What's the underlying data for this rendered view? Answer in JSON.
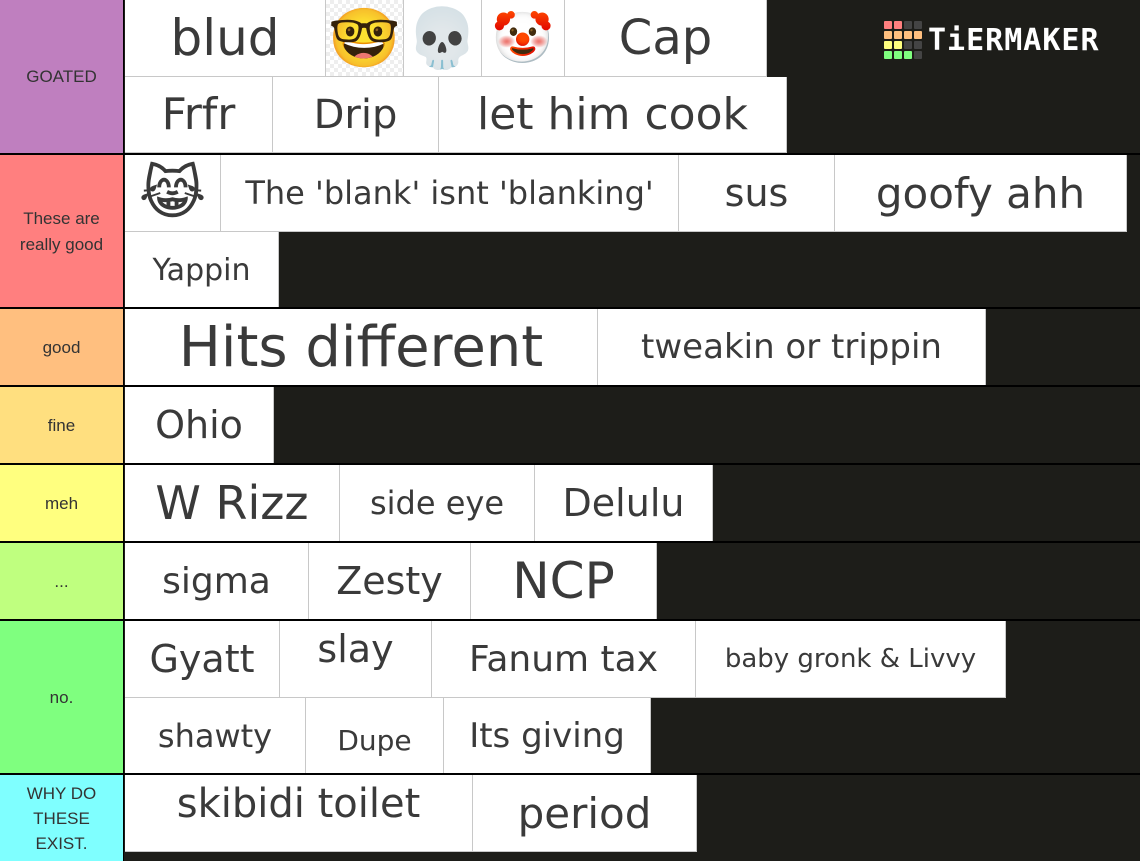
{
  "logo": {
    "text": "TiERMAKER",
    "grid_colors": [
      "#ff7f7f",
      "#ff7f7f",
      "#444444",
      "#444444",
      "#ffbf7f",
      "#ffbf7f",
      "#ffbf7f",
      "#ffbf7f",
      "#ffff7f",
      "#ffff7f",
      "#444444",
      "#444444",
      "#7fff7f",
      "#7fff7f",
      "#7fff7f",
      "#444444"
    ]
  },
  "tiers": [
    {
      "label": "GOATED",
      "color": "#bf7fbf",
      "items": [
        {
          "text": "blud",
          "type": "text"
        },
        {
          "text": "🤓",
          "type": "emoji",
          "name": "nerd-face-emoji"
        },
        {
          "text": "💀",
          "type": "emoji",
          "name": "skull-emoji"
        },
        {
          "text": "🤡",
          "type": "emoji",
          "name": "clown-face-emoji"
        },
        {
          "text": "Cap",
          "type": "text"
        },
        {
          "text": "Frfr",
          "type": "text"
        },
        {
          "text": "Drip",
          "type": "text"
        },
        {
          "text": "let him cook",
          "type": "text"
        }
      ]
    },
    {
      "label": "These are really good",
      "color": "#ff7f7f",
      "items": [
        {
          "text": "😹",
          "type": "emoji",
          "name": "cat-tears-of-joy-emoji"
        },
        {
          "text": "The 'blank' isnt 'blanking'",
          "type": "text"
        },
        {
          "text": "sus",
          "type": "text"
        },
        {
          "text": "goofy ahh",
          "type": "text"
        },
        {
          "text": "Yappin",
          "type": "text"
        }
      ]
    },
    {
      "label": "good",
      "color": "#ffbf7f",
      "items": [
        {
          "text": "Hits different",
          "type": "text"
        },
        {
          "text": "tweakin or trippin",
          "type": "text"
        }
      ]
    },
    {
      "label": "fine",
      "color": "#ffdf7f",
      "items": [
        {
          "text": "Ohio",
          "type": "text"
        }
      ]
    },
    {
      "label": "meh",
      "color": "#ffff7f",
      "items": [
        {
          "text": "W Rizz",
          "type": "text"
        },
        {
          "text": "side eye",
          "type": "text"
        },
        {
          "text": "Delulu",
          "type": "text"
        }
      ]
    },
    {
      "label": "...",
      "color": "#bfff7f",
      "items": [
        {
          "text": "sigma",
          "type": "text"
        },
        {
          "text": "Zesty",
          "type": "text"
        },
        {
          "text": "NCP",
          "type": "text"
        }
      ]
    },
    {
      "label": "no.",
      "color": "#7fff7f",
      "items": [
        {
          "text": "Gyatt",
          "type": "text"
        },
        {
          "text": "slay",
          "type": "text"
        },
        {
          "text": "Fanum tax",
          "type": "text"
        },
        {
          "text": "baby gronk & Livvy",
          "type": "text"
        },
        {
          "text": "shawty",
          "type": "text"
        },
        {
          "text": "Dupe",
          "type": "text"
        },
        {
          "text": "Its giving",
          "type": "text"
        }
      ]
    },
    {
      "label": "WHY DO THESE EXIST.",
      "color": "#7fffff",
      "items": [
        {
          "text": "skibidi toilet",
          "type": "text"
        },
        {
          "text": "period",
          "type": "text"
        }
      ]
    }
  ]
}
